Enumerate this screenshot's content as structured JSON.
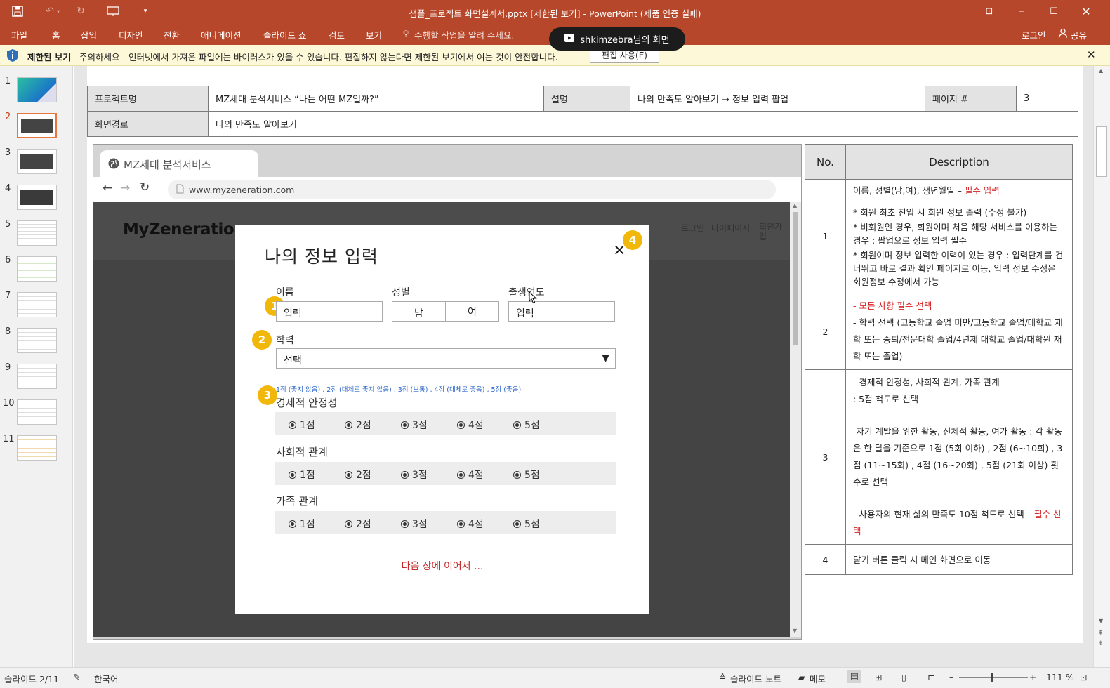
{
  "window": {
    "title": "샘플_프로젝트 화면설계서.pptx [제한된 보기] - PowerPoint (제품 인증 실패)"
  },
  "ribbon": {
    "tabs": [
      "파일",
      "홈",
      "삽입",
      "디자인",
      "전환",
      "애니메이션",
      "슬라이드 쇼",
      "검토",
      "보기"
    ],
    "tell_me": "수행할 작업을 알려 주세요.",
    "login": "로그인",
    "share": "공유"
  },
  "screenshare": {
    "label": "shkimzebra님의 화면"
  },
  "msgbar": {
    "title": "제한된 보기",
    "text": "주의하세요—인터넷에서 가져온 파일에는 바이러스가 있을 수 있습니다. 편집하지 않는다면 제한된 보기에서 여는 것이 안전합니다.",
    "button": "편집 사용(E)"
  },
  "thumbnails": {
    "numbers": [
      "1",
      "2",
      "3",
      "4",
      "5",
      "6",
      "7",
      "8",
      "9",
      "10",
      "11"
    ],
    "selected": "2"
  },
  "slide": {
    "header": {
      "project_label": "프로젝트명",
      "project_value": "MZ세대 분석서비스 “나는 어떤 MZ일까?”",
      "desc_label": "설명",
      "desc_value": "나의 만족도 알아보기 → 정보 입력 팝업",
      "page_label": "페이지 #",
      "page_value": "3",
      "path_label": "화면경로",
      "path_value": "나의 만족도 알아보기"
    },
    "browser": {
      "tab": "MZ세대 분석서비스",
      "url": "www.myzeneration.com",
      "logo": "MyZeneration",
      "nav": [
        "로그인",
        "마이페이지",
        "회원가입"
      ]
    },
    "modal": {
      "title": "나의 정보 입력",
      "close": "×",
      "name_label": "이름",
      "name_value": "입력",
      "gender_label": "성별",
      "gender_male": "남",
      "gender_female": "여",
      "year_label": "출생연도",
      "year_value": "입력",
      "edu_label": "학력",
      "edu_value": "선택",
      "scale_hint": "1점 (좋지 않음) , 2점 (대체로 좋지 않음) , 3점 (보통) , 4점 (대체로 좋음) , 5점 (좋음)",
      "groups": [
        {
          "label": "경제적 안정성"
        },
        {
          "label": "사회적 관계"
        },
        {
          "label": "가족 관계"
        }
      ],
      "options": [
        "1점",
        "2점",
        "3점",
        "4점",
        "5점"
      ],
      "continue": "다음 장에 이어서 ...",
      "badges": [
        "1",
        "2",
        "3",
        "4"
      ]
    },
    "desc": {
      "col_no": "No.",
      "col_desc": "Description",
      "r1": {
        "no": "1",
        "l1a": "이름, 성별(남,여), 생년월일 – ",
        "l1b": "필수 입력",
        "l2": "* 회원 최초 진입 시 회원 정보 출력 (수정 불가)",
        "l3": "* 비회원인 경우, 회원이며 처음 해당 서비스를 이용하는 경우 : 팝업으로 정보 입력 필수",
        "l4": "* 회원이며 정보 입력한 이력이 있는 경우 : 입력단계를 건너뛰고 바로 결과 확인 페이지로 이동, 입력 정보 수정은 회원정보 수정에서 가능"
      },
      "r2": {
        "no": "2",
        "l1": "- 모든 사항 필수 선택",
        "l2": "- 학력 선택 (고등학교 졸업 미만/고등학교 졸업/대학교 재학 또는 중퇴/전문대학 졸업/4년제 대학교 졸업/대학원 재학 또는 졸업)"
      },
      "r3": {
        "no": "3",
        "l1": "- 경제적 안정성, 사회적 관계, 가족 관계",
        "l2": ":  5점 척도로 선택",
        "l3": "-자기 계발을 위한 활동, 신체적 활동, 여가 활동 : 각 활동은 한 달을 기준으로 1점 (5회 이하) , 2점 (6~10회) , 3점 (11~15회) , 4점 (16~20회) , 5점 (21회 이상) 횟수로 선택",
        "l4a": "- 사용자의 현재 삶의 만족도 10점 척도로 선택 – ",
        "l4b": "필수 선택"
      },
      "r4": {
        "no": "4",
        "l1": "닫기 버튼 클릭 시 메인 화면으로 이동"
      }
    }
  },
  "status": {
    "slide": "슬라이드 2/11",
    "lang": "한국어",
    "notes": "슬라이드 노트",
    "comments": "메모",
    "zoom": "111 %"
  }
}
